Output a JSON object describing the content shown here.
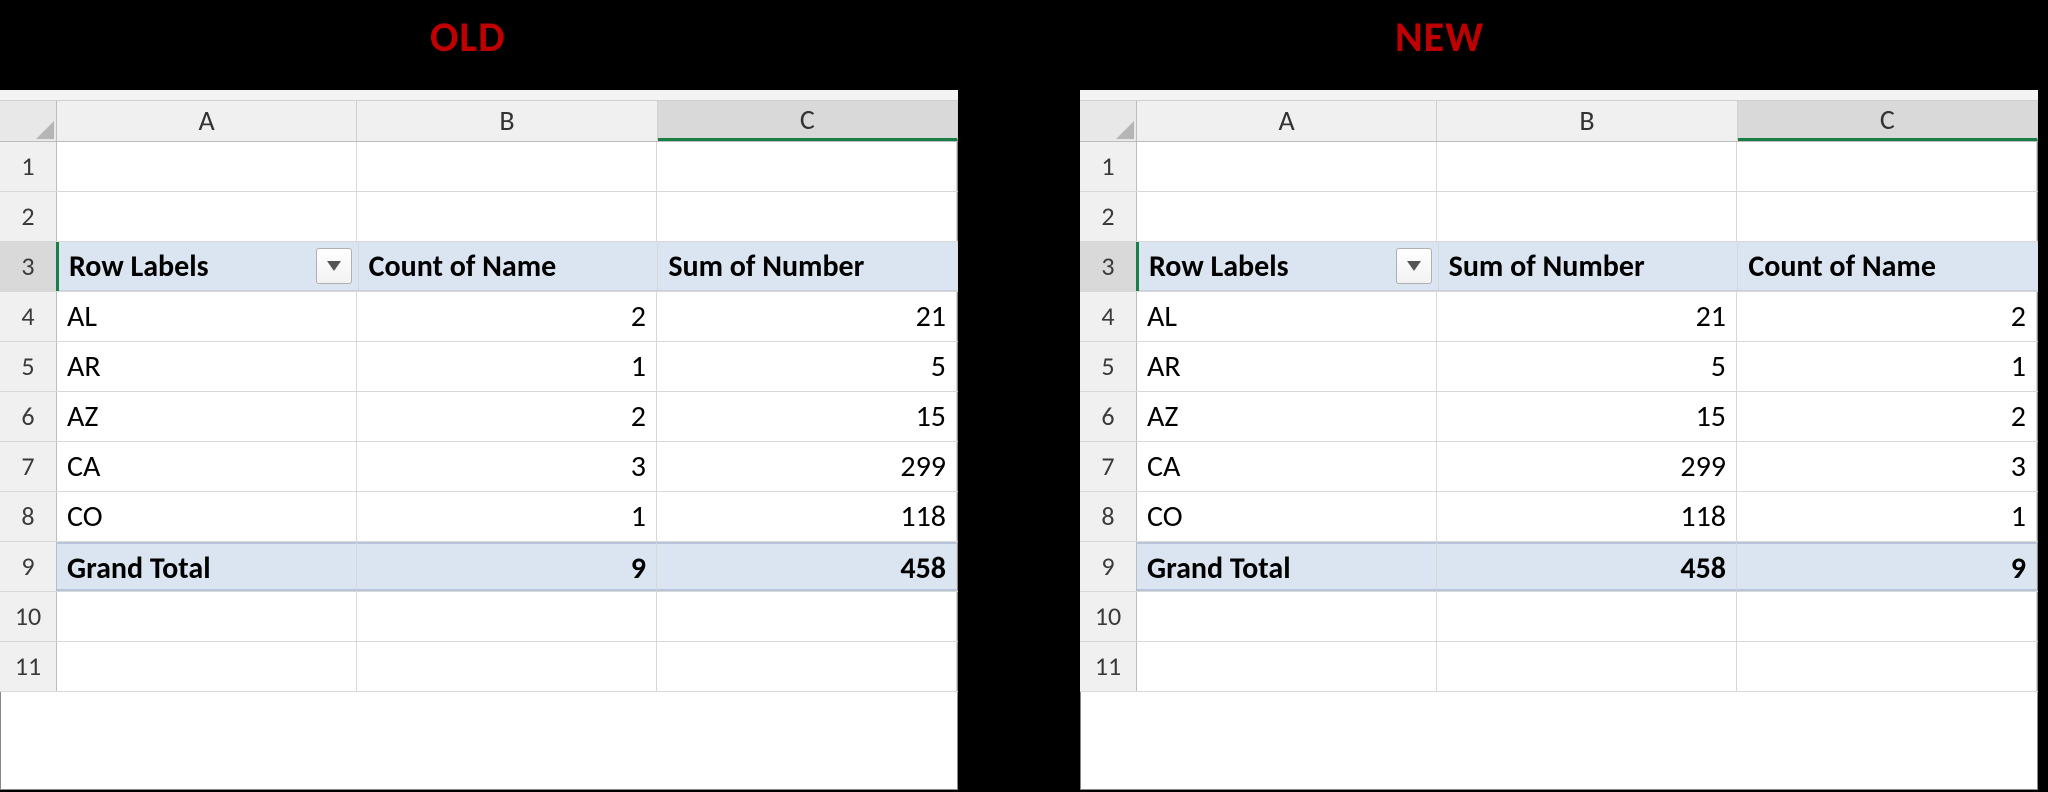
{
  "titles": {
    "old": "OLD",
    "new": "NEW"
  },
  "columns": [
    "A",
    "B",
    "C"
  ],
  "row_numbers": [
    "1",
    "2",
    "3",
    "4",
    "5",
    "6",
    "7",
    "8",
    "9",
    "10",
    "11"
  ],
  "old": {
    "headers": {
      "a": "Row Labels",
      "b": "Count of Name",
      "c": "Sum of Number"
    },
    "rows": [
      {
        "a": "AL",
        "b": "2",
        "c": "21"
      },
      {
        "a": "AR",
        "b": "1",
        "c": "5"
      },
      {
        "a": "AZ",
        "b": "2",
        "c": "15"
      },
      {
        "a": "CA",
        "b": "3",
        "c": "299"
      },
      {
        "a": "CO",
        "b": "1",
        "c": "118"
      }
    ],
    "grand": {
      "a": "Grand Total",
      "b": "9",
      "c": "458"
    },
    "active_cell": "C3"
  },
  "new": {
    "headers": {
      "a": "Row Labels",
      "b": "Sum of Number",
      "c": "Count of Name"
    },
    "rows": [
      {
        "a": "AL",
        "b": "21",
        "c": "2"
      },
      {
        "a": "AR",
        "b": "5",
        "c": "1"
      },
      {
        "a": "AZ",
        "b": "15",
        "c": "2"
      },
      {
        "a": "CA",
        "b": "299",
        "c": "3"
      },
      {
        "a": "CO",
        "b": "118",
        "c": "1"
      }
    ],
    "grand": {
      "a": "Grand Total",
      "b": "458",
      "c": "9"
    },
    "active_cell": "C3"
  },
  "chart_data": [
    {
      "type": "table",
      "title": "OLD pivot table",
      "columns": [
        "Row Labels",
        "Count of Name",
        "Sum of Number"
      ],
      "rows": [
        [
          "AL",
          2,
          21
        ],
        [
          "AR",
          1,
          5
        ],
        [
          "AZ",
          2,
          15
        ],
        [
          "CA",
          3,
          299
        ],
        [
          "CO",
          1,
          118
        ],
        [
          "Grand Total",
          9,
          458
        ]
      ]
    },
    {
      "type": "table",
      "title": "NEW pivot table",
      "columns": [
        "Row Labels",
        "Sum of Number",
        "Count of Name"
      ],
      "rows": [
        [
          "AL",
          21,
          2
        ],
        [
          "AR",
          5,
          1
        ],
        [
          "AZ",
          15,
          2
        ],
        [
          "CA",
          299,
          3
        ],
        [
          "CO",
          118,
          1
        ],
        [
          "Grand Total",
          458,
          9
        ]
      ]
    }
  ]
}
